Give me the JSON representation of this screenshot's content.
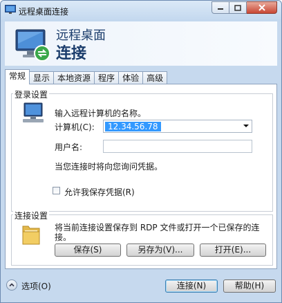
{
  "window": {
    "title": "远程桌面连接",
    "controls": {
      "minimize_icon": "minimize-icon",
      "maximize_icon": "maximize-icon",
      "close_icon": "close-icon"
    }
  },
  "banner": {
    "line1": "远程桌面",
    "line2": "连接"
  },
  "tabs": [
    "常规",
    "显示",
    "本地资源",
    "程序",
    "体验",
    "高级"
  ],
  "active_tab": "常规",
  "login_settings": {
    "title": "登录设置",
    "prompt": "输入远程计算机的名称。",
    "computer_label": "计算机(C):",
    "computer_value": "12.34.56.78",
    "username_label": "用户名:",
    "username_value": "",
    "credential_note": "当您连接时将向您询问凭据。",
    "save_credentials_label": "允许我保存凭据(R)",
    "save_credentials_checked": false
  },
  "connection_settings": {
    "title": "连接设置",
    "description_line1": "将当前连接设置保存到 RDP 文件或打开一个已保存的连",
    "description_line2": "接。",
    "save_button": "保存(S)",
    "save_as_button": "另存为(V)...",
    "open_button": "打开(E)..."
  },
  "footer": {
    "options_label": "选项(O)",
    "connect_button": "连接(N)",
    "help_button": "帮助(H)"
  }
}
